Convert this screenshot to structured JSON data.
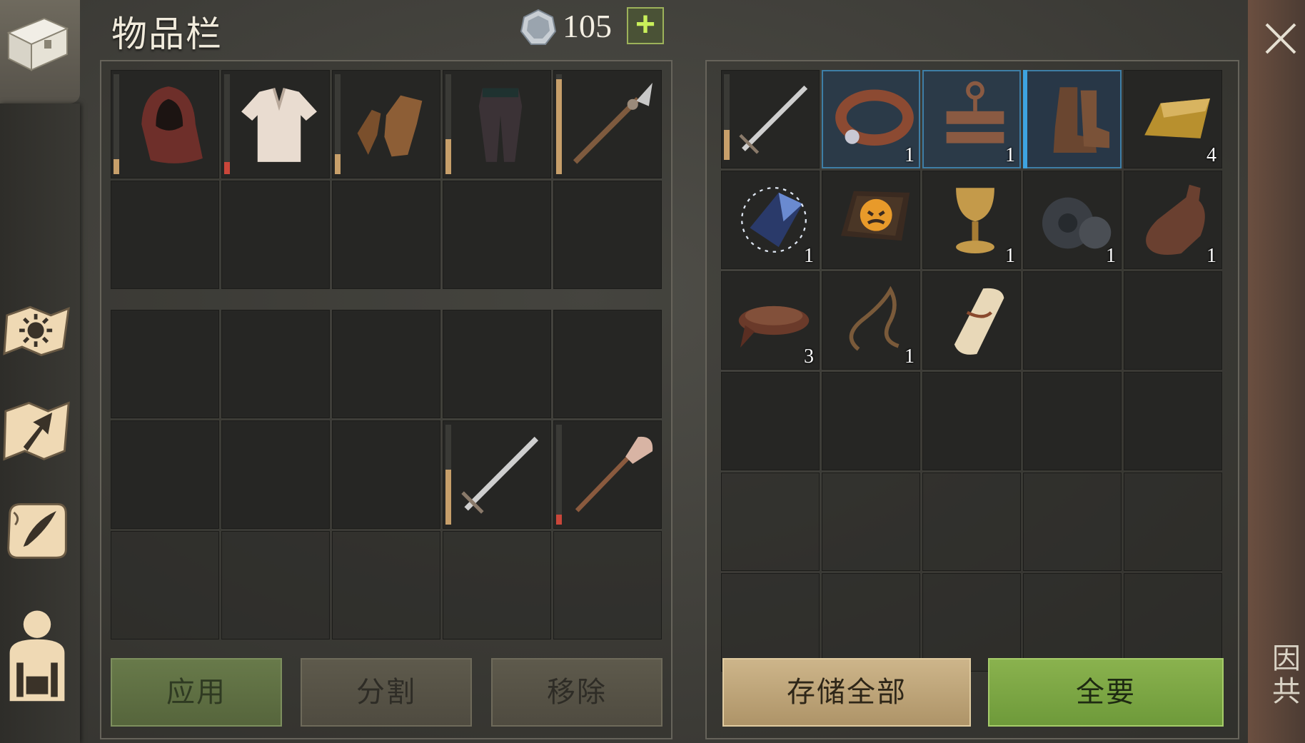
{
  "header": {
    "title": "物品栏",
    "coins": "105",
    "add_label": "+"
  },
  "colors": {
    "durability_ok": "#c79f6a",
    "durability_low": "#c9463a",
    "highlight": "#3ea3e0",
    "accept_green": "#7ea746"
  },
  "sidebar": {
    "items": [
      {
        "icon": "chest-icon"
      },
      {
        "icon": "sun-map-icon"
      },
      {
        "icon": "arrow-map-icon"
      },
      {
        "icon": "quill-scroll-icon"
      },
      {
        "icon": "character-icon"
      }
    ],
    "side_glyph": "因\n共"
  },
  "equipment": [
    {
      "item": "hood",
      "durability": 0.15,
      "level": "ok"
    },
    {
      "item": "tunic",
      "durability": 0.12,
      "level": "low"
    },
    {
      "item": "gloves",
      "durability": 0.2,
      "level": "ok"
    },
    {
      "item": "pants",
      "durability": 0.35,
      "level": "ok"
    },
    {
      "item": "spear",
      "durability": 0.95,
      "level": "ok"
    }
  ],
  "backpack": [
    {
      "item": "empty"
    },
    {
      "item": "empty"
    },
    {
      "item": "empty"
    },
    {
      "item": "empty"
    },
    {
      "item": "empty"
    },
    {
      "item": "empty"
    },
    {
      "item": "empty"
    },
    {
      "item": "empty"
    },
    {
      "item": "sword",
      "durability": 0.55,
      "level": "ok"
    },
    {
      "item": "shovel",
      "durability": 0.1,
      "level": "low"
    }
  ],
  "storage": [
    {
      "item": "sword",
      "qty": "",
      "durability": 0.35
    },
    {
      "item": "collar",
      "qty": "1",
      "highlight": "hl"
    },
    {
      "item": "stocks",
      "qty": "1",
      "highlight": "hl"
    },
    {
      "item": "boots",
      "qty": "",
      "highlight": "hl-strong"
    },
    {
      "item": "gold-bar",
      "qty": "4"
    },
    {
      "item": "crystal",
      "qty": "1"
    },
    {
      "item": "book",
      "qty": ""
    },
    {
      "item": "goblet",
      "qty": "1"
    },
    {
      "item": "gears",
      "qty": "1"
    },
    {
      "item": "bottle",
      "qty": "1"
    },
    {
      "item": "leather",
      "qty": "3"
    },
    {
      "item": "rope",
      "qty": "1"
    },
    {
      "item": "scroll",
      "qty": ""
    }
  ],
  "buttons": {
    "apply": "应用",
    "split": "分割",
    "remove": "移除",
    "store_all": "存储全部",
    "take_all": "全要"
  }
}
